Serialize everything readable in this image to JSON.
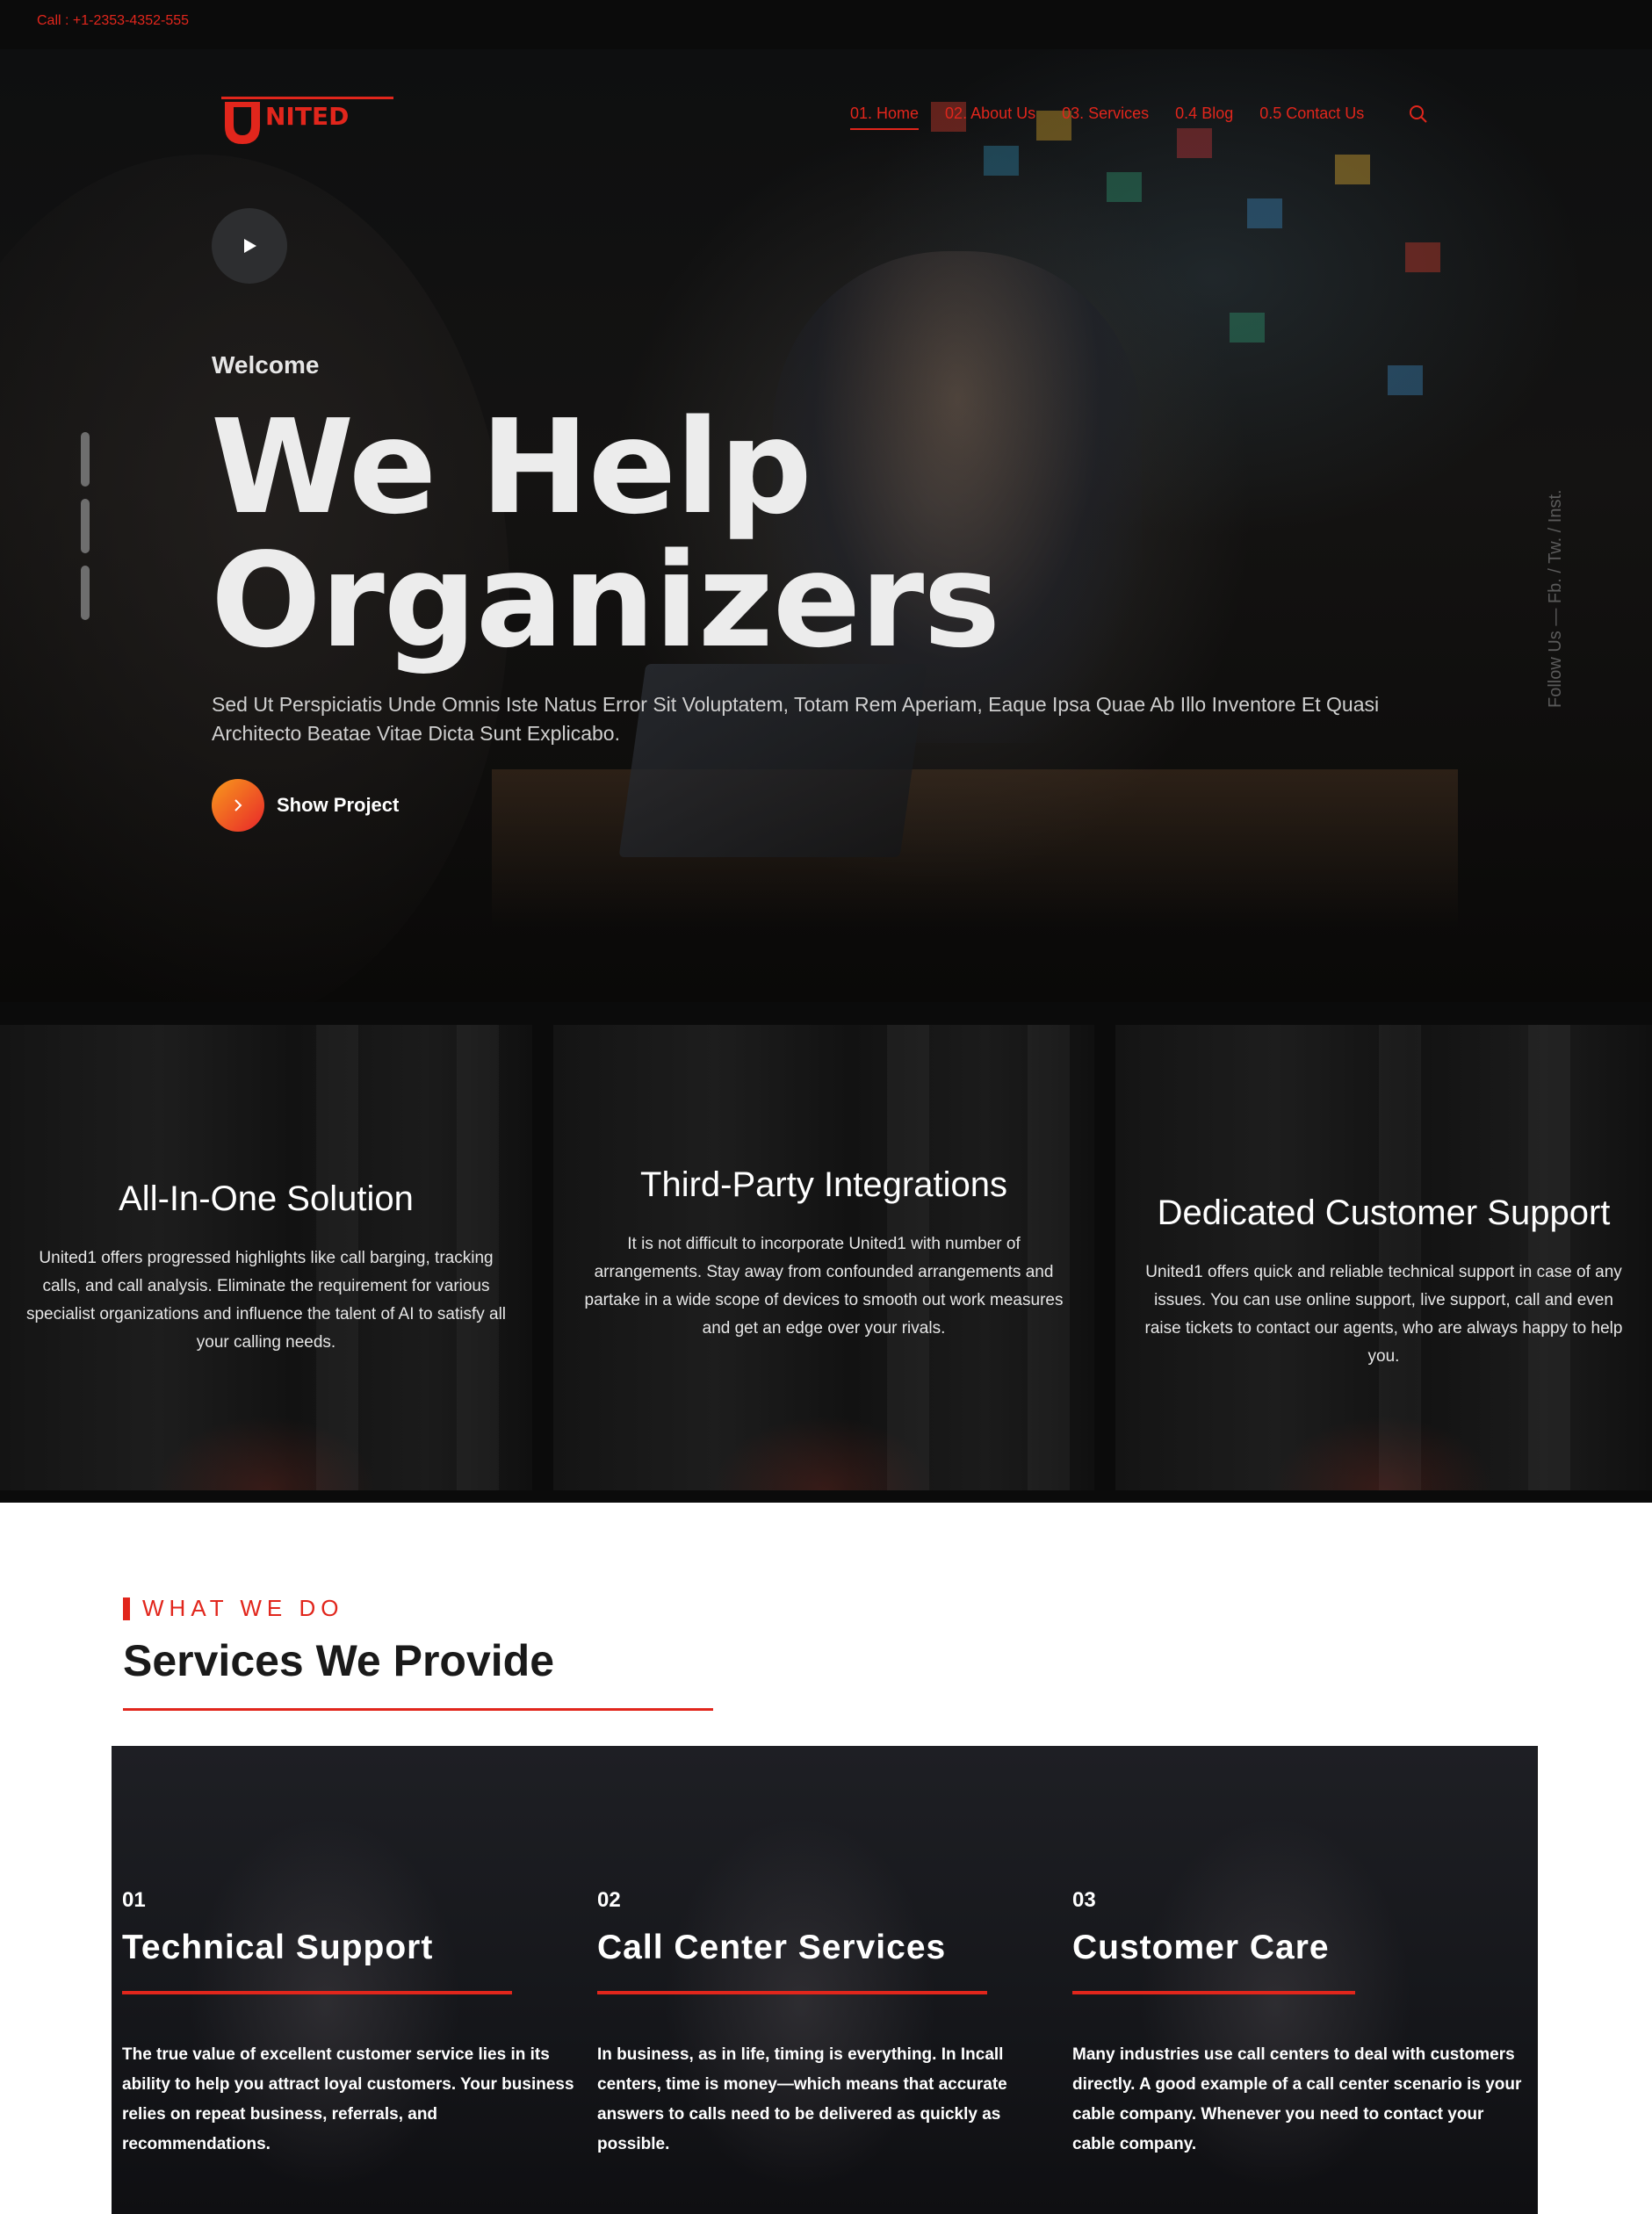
{
  "topbar": {
    "call_text": "Call : +1-2353-4352-555"
  },
  "logo": {
    "mark": "U",
    "wordmark": "NITED"
  },
  "nav": {
    "items": [
      {
        "label": "01. Home",
        "active": true
      },
      {
        "label": "02. About Us",
        "active": false
      },
      {
        "label": "03. Services",
        "active": false
      },
      {
        "label": "0.4 Blog",
        "active": false
      },
      {
        "label": "0.5 Contact Us",
        "active": false
      }
    ],
    "search_icon": "search-icon"
  },
  "hero": {
    "welcome": "Welcome",
    "headline_line1": "We Help",
    "headline_line2": "Organizers",
    "subtitle": "Sed Ut Perspiciatis Unde Omnis Iste Natus Error Sit Voluptatem, Totam Rem Aperiam, Eaque Ipsa Quae Ab Illo Inventore Et Quasi Architecto Beatae Vitae Dicta Sunt Explicabo.",
    "cta_label": "Show Project",
    "social": "Follow Us — Fb. / Tw. / Inst."
  },
  "features": [
    {
      "title": "All-In-One Solution",
      "text": "United1 offers progressed highlights like call barging, tracking calls, and call analysis. Eliminate the requirement for various specialist organizations and influence the talent of AI to satisfy all your calling needs."
    },
    {
      "title": "Third-Party Integrations",
      "text": "It is not difficult to incorporate United1 with number of arrangements. Stay away from confounded arrangements and partake in a wide scope of devices to smooth out work measures and get an edge over your rivals."
    },
    {
      "title": "Dedicated Customer Support",
      "text": "United1 offers quick and reliable technical support in case of any issues. You can use online support, live support, call and even raise tickets to contact our agents, who are always happy to help you."
    }
  ],
  "services_section": {
    "kicker": "WHAT WE DO",
    "title": "Services We Provide",
    "items": [
      {
        "number": "01",
        "title": "Technical Support",
        "text": "The true value of excellent customer service lies in its ability to help you attract loyal customers. Your business relies on repeat business, referrals, and recommendations."
      },
      {
        "number": "02",
        "title": "Call Center Services",
        "text": "In business, as in life, timing is everything. In Incall centers, time is money—which means that accurate answers to calls need to be delivered as quickly as possible."
      },
      {
        "number": "03",
        "title": "Customer Care",
        "text": "Many industries use call centers to deal with customers directly. A good example of a call center scenario is your cable company. Whenever you need to contact your cable company."
      }
    ]
  },
  "colors": {
    "accent": "#e1261c",
    "dark": "#0b0b0b",
    "cta_gradient_start": "#f89a1c",
    "cta_gradient_end": "#e8262a"
  }
}
